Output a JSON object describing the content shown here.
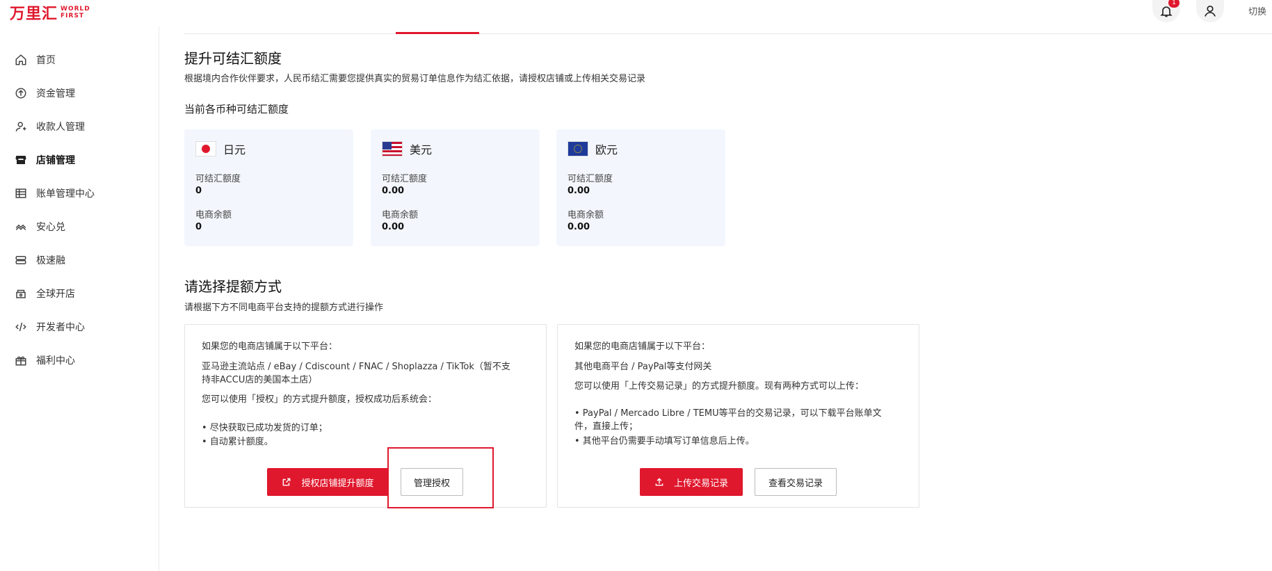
{
  "header": {
    "logo_cn": "万里汇",
    "logo_en_1": "WORLD",
    "logo_en_2": "FIRST",
    "notification_count": "1",
    "switch_label": "切换"
  },
  "sidebar": {
    "items": [
      {
        "label": "首页",
        "icon": "home-icon"
      },
      {
        "label": "资金管理",
        "icon": "fund-icon"
      },
      {
        "label": "收款人管理",
        "icon": "payee-icon"
      },
      {
        "label": "店铺管理",
        "icon": "store-icon",
        "active": true
      },
      {
        "label": "账单管理中心",
        "icon": "bill-icon"
      },
      {
        "label": "安心兑",
        "icon": "exchange-icon"
      },
      {
        "label": "极速融",
        "icon": "finance-icon"
      },
      {
        "label": "全球开店",
        "icon": "shop-icon"
      },
      {
        "label": "开发者中心",
        "icon": "developer-icon"
      },
      {
        "label": "福利中心",
        "icon": "gift-icon"
      }
    ]
  },
  "main": {
    "title": "提升可结汇额度",
    "subtitle": "根据境内合作伙伴要求，人民币结汇需要您提供真实的贸易订单信息作为结汇依据，请授权店铺或上传相关交易记录",
    "currency_section_title": "当前各币种可结汇额度",
    "currencies": [
      {
        "name": "日元",
        "flag": "jp-flag",
        "quota_label": "可结汇额度",
        "quota": "0",
        "balance_label": "电商余额",
        "balance": "0"
      },
      {
        "name": "美元",
        "flag": "us-flag",
        "quota_label": "可结汇额度",
        "quota": "0.00",
        "balance_label": "电商余额",
        "balance": "0.00"
      },
      {
        "name": "欧元",
        "flag": "eu-flag",
        "quota_label": "可结汇额度",
        "quota": "0.00",
        "balance_label": "电商余额",
        "balance": "0.00"
      }
    ],
    "method_title": "请选择提额方式",
    "method_subtitle": "请根据下方不同电商平台支持的提额方式进行操作",
    "panel_left": {
      "line1": "如果您的电商店铺属于以下平台：",
      "line2a": "亚马逊主流站点 / eBay / Cdiscount / FNAC / Shoplazza / TikTok（暂不支",
      "line2b": "持非ACCU店的美国本土店）",
      "line3": "您可以使用「授权」的方式提升额度，授权成功后系统会：",
      "bullet1": "• 尽快获取已成功发货的订单；",
      "bullet2": "• 自动累计额度。",
      "primary_button": "授权店铺提升额度",
      "secondary_button": "管理授权"
    },
    "panel_right": {
      "line1": "如果您的电商店铺属于以下平台：",
      "line2": "其他电商平台 / PayPal等支付网关",
      "line3": "您可以使用「上传交易记录」的方式提升额度。现有两种方式可以上传：",
      "bullet1a": "• PayPal / Mercado Libre / TEMU等平台的交易记录，可以下载平台账单文",
      "bullet1b": "件，直接上传；",
      "bullet2": "• 其他平台仍需要手动填写订单信息后上传。",
      "primary_button": "上传交易记录",
      "secondary_button": "查看交易记录"
    }
  },
  "colors": {
    "accent": "#e0182d",
    "card_bg": "#f3f7fd"
  }
}
